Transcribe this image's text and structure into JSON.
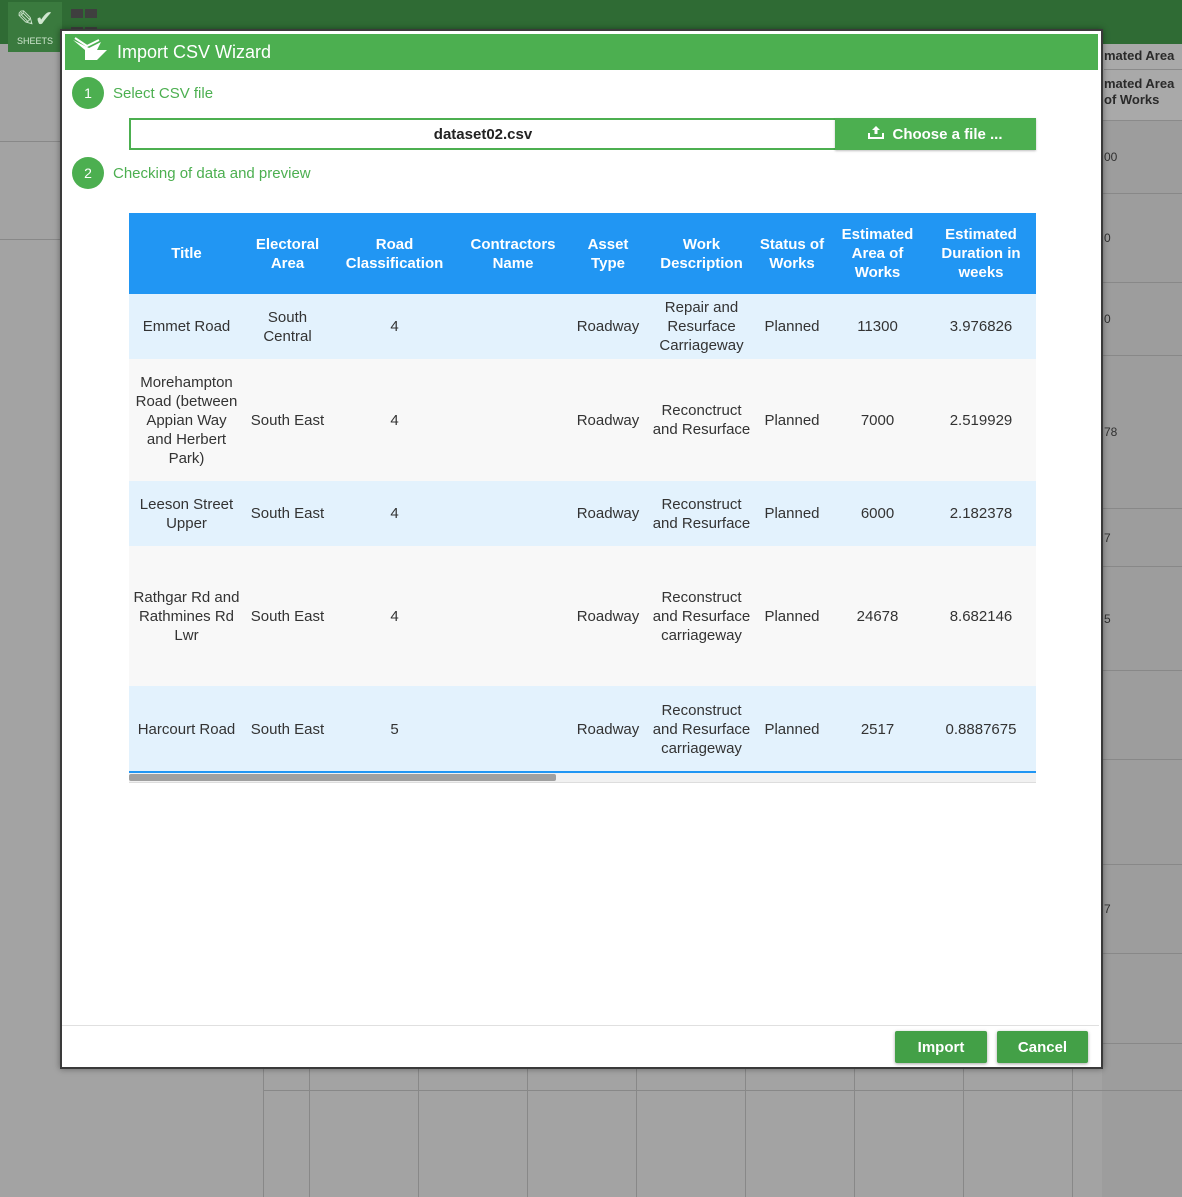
{
  "background": {
    "sheets_label": "SHEETS",
    "right_header_line1": "mated Area",
    "right_header_line2": "mated Area of Works",
    "right_cells": [
      "00",
      "0",
      "0",
      "78",
      "7",
      "5",
      "",
      "",
      "7",
      ""
    ]
  },
  "dialog": {
    "title": "Import CSV Wizard",
    "step1": {
      "number": "1",
      "label": "Select CSV file"
    },
    "step2": {
      "number": "2",
      "label": "Checking of data and preview"
    },
    "file_name": "dataset02.csv",
    "choose_file_label": "Choose a file ...",
    "import_label": "Import",
    "cancel_label": "Cancel"
  },
  "table": {
    "headers": [
      "Title",
      "Electoral Area",
      "Road Classification",
      "Contractors Name",
      "Asset Type",
      "Work Description",
      "Status of Works",
      "Estimated Area of Works",
      "Estimated Duration in weeks"
    ],
    "rows": [
      [
        "Emmet Road",
        "South Central",
        "4",
        "",
        "Roadway",
        "Repair and Resurface Carriageway",
        "Planned",
        "11300",
        "3.976826"
      ],
      [
        "Morehampton Road (between Appian Way and Herbert Park)",
        "South East",
        "4",
        "",
        "Roadway",
        "Reconctruct and Resurface",
        "Planned",
        "7000",
        "2.519929"
      ],
      [
        "Leeson Street Upper",
        "South East",
        "4",
        "",
        "Roadway",
        "Reconstruct and Resurface",
        "Planned",
        "6000",
        "2.182378"
      ],
      [
        "Rathgar Rd and Rathmines Rd Lwr",
        "South East",
        "4",
        "",
        "Roadway",
        "Reconstruct and Resurface carriageway",
        "Planned",
        "24678",
        "8.682146"
      ],
      [
        "Harcourt Road",
        "South East",
        "5",
        "",
        "Roadway",
        "Reconstruct and Resurface carriageway",
        "Planned",
        "2517",
        "0.8887675"
      ]
    ]
  },
  "colors": {
    "accent_green": "#4caf50",
    "table_header_blue": "#2196f3",
    "row_tint": "#e3f2fd"
  }
}
